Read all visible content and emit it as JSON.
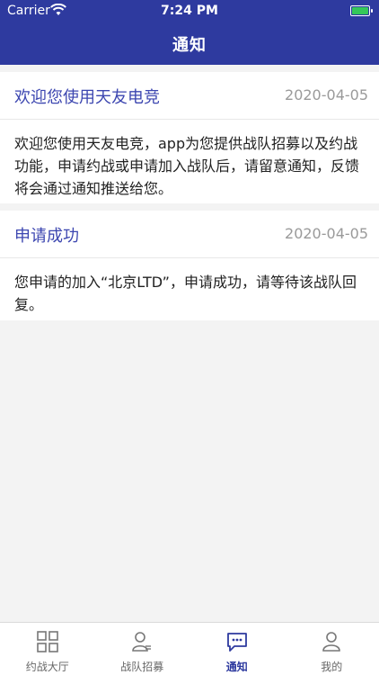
{
  "status_bar": {
    "carrier": "Carrier",
    "time": "7:24 PM"
  },
  "header": {
    "title": "通知"
  },
  "notifications": [
    {
      "title": "欢迎您使用天友电竞",
      "date": "2020-04-05",
      "body": "欢迎您使用天友电竞，app为您提供战队招募以及约战功能，申请约战或申请加入战队后，请留意通知，反馈将会通过通知推送给您。"
    },
    {
      "title": "申请成功",
      "date": "2020-04-05",
      "body": "您申请的加入“北京LTD”，申请成功，请等待该战队回复。"
    }
  ],
  "tabs": [
    {
      "label": "约战大厅",
      "icon": "grid-icon"
    },
    {
      "label": "战队招募",
      "icon": "team-icon"
    },
    {
      "label": "通知",
      "icon": "message-icon",
      "active": true
    },
    {
      "label": "我的",
      "icon": "person-icon"
    }
  ],
  "colors": {
    "accent": "#2e3a9f",
    "title": "#3c46b0",
    "background": "#f3f3f3"
  }
}
